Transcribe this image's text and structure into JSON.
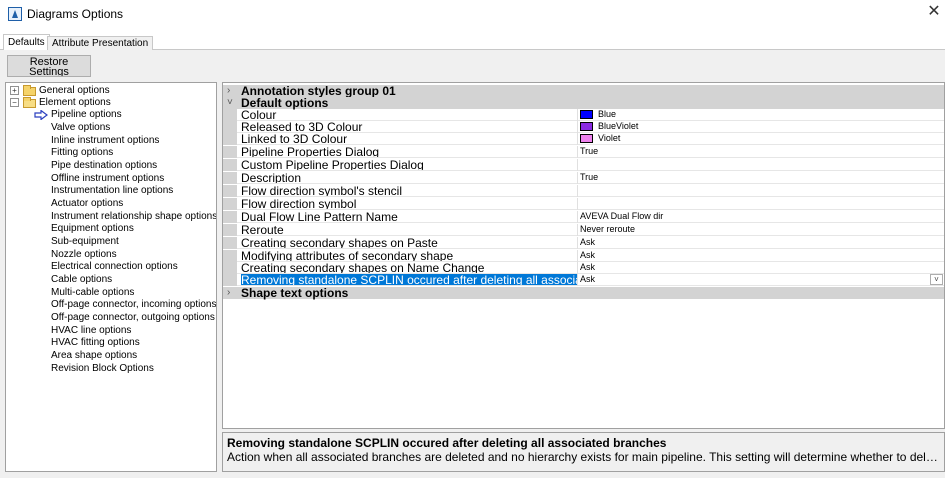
{
  "window": {
    "title": "Diagrams Options",
    "close_glyph": "✕"
  },
  "tabs": [
    {
      "label": "Defaults",
      "active": true
    },
    {
      "label": "Attribute Presentation",
      "active": false
    }
  ],
  "restore_button": {
    "line1": "Restore",
    "line2": "Settings"
  },
  "tree": {
    "expand_glyph": "+",
    "collapse_glyph": "−",
    "roots": [
      {
        "label": "General options",
        "expanded": false,
        "icon": "folder-icon"
      },
      {
        "label": "Element options",
        "expanded": true,
        "icon": "folder-open-icon"
      }
    ],
    "children": [
      {
        "label": "Pipeline options",
        "selected": true,
        "icon": "arrow-pointer-icon"
      },
      {
        "label": "Valve options"
      },
      {
        "label": "Inline instrument options"
      },
      {
        "label": "Fitting options"
      },
      {
        "label": "Pipe destination options"
      },
      {
        "label": "Offline instrument options"
      },
      {
        "label": "Instrumentation line options"
      },
      {
        "label": "Actuator options"
      },
      {
        "label": "Instrument relationship shape options"
      },
      {
        "label": "Equipment options"
      },
      {
        "label": "Sub-equipment"
      },
      {
        "label": "Nozzle options"
      },
      {
        "label": "Electrical connection options"
      },
      {
        "label": "Cable options"
      },
      {
        "label": "Multi-cable options"
      },
      {
        "label": "Off-page connector, incoming options"
      },
      {
        "label": "Off-page connector, outgoing options"
      },
      {
        "label": "HVAC line options"
      },
      {
        "label": "HVAC fitting options"
      },
      {
        "label": "Area shape options"
      },
      {
        "label": "Revision Block Options"
      }
    ]
  },
  "grid": {
    "collapsed_glyph": "›",
    "expanded_glyph": "˅",
    "dropdown_glyph": "˅",
    "categories": {
      "annotation": "Annotation styles group 01",
      "default": "Default options",
      "shape_text": "Shape text options"
    },
    "properties": [
      {
        "name": "Colour",
        "value": "Blue",
        "swatch": "#0000ff"
      },
      {
        "name": "Released to 3D Colour",
        "value": "BlueViolet",
        "swatch": "#8a2be2"
      },
      {
        "name": "Linked to 3D Colour",
        "value": "Violet",
        "swatch": "#ee82ee"
      },
      {
        "name": "Pipeline Properties Dialog",
        "value": "True"
      },
      {
        "name": "Custom Pipeline Properties Dialog",
        "value": ""
      },
      {
        "name": "Description",
        "value": "True"
      },
      {
        "name": "Flow direction symbol's stencil",
        "value": ""
      },
      {
        "name": "Flow direction symbol",
        "value": ""
      },
      {
        "name": "Dual Flow Line Pattern Name",
        "value": "AVEVA Dual Flow dir"
      },
      {
        "name": "Reroute",
        "value": "Never reroute"
      },
      {
        "name": "Creating secondary shapes on Paste",
        "value": "Ask"
      },
      {
        "name": "Modifying attributes of secondary shape",
        "value": "Ask"
      },
      {
        "name": "Creating secondary shapes on Name Change",
        "value": "Ask"
      },
      {
        "name": "Removing standalone SCPLIN occured after deleting all associated branches",
        "value": "Ask",
        "selected": true
      }
    ]
  },
  "help": {
    "title": "Removing standalone SCPLIN occured after deleting all associated branches",
    "text": "Action when all associated branches are deleted and no hierarchy exists for main pipeline. This setting will determine whether to delete t..."
  },
  "colors": {
    "selection": "#0078d7",
    "category_bg": "#d3d3d3",
    "panel_bg": "#f0f0f0"
  }
}
